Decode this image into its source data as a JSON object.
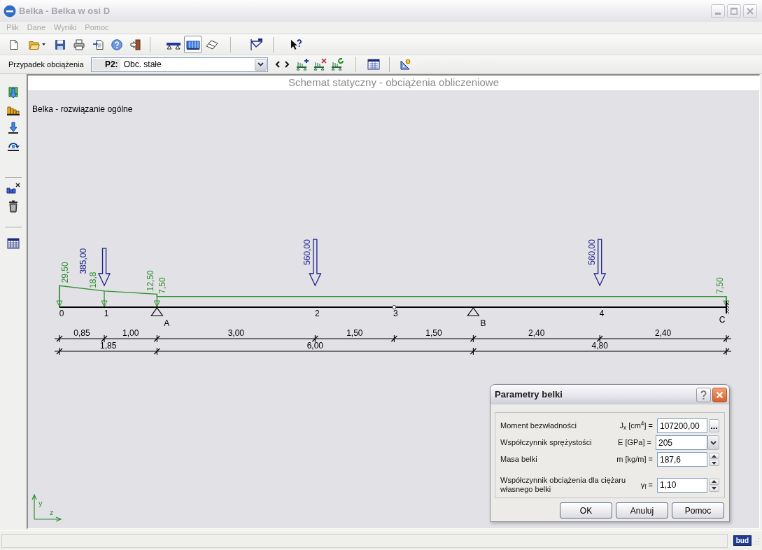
{
  "window": {
    "title": "Belka - Belka w osi D",
    "active": false
  },
  "menu": [
    {
      "label": "Plik",
      "disabled": true
    },
    {
      "label": "Dane",
      "disabled": true
    },
    {
      "label": "Wyniki",
      "disabled": true
    },
    {
      "label": "Pomoc",
      "disabled": true
    }
  ],
  "toolbar": {
    "view_buttons": [
      {
        "kind": "beam",
        "selected": false
      },
      {
        "kind": "loads",
        "selected": true
      },
      {
        "kind": "eraser",
        "selected": false
      }
    ]
  },
  "load_case_bar": {
    "label": "Przypadek obciążenia",
    "case_code": "P2:",
    "case_name": "Obc. stałe"
  },
  "canvas": {
    "title": "Schemat statyczny - obciążenia obliczeniowe",
    "subtitle": "Belka - rozwiązanie ogólne",
    "points": [
      {
        "kind": "node",
        "label": "0",
        "loads": [
          "29,50"
        ]
      },
      {
        "kind": "node",
        "label": "1",
        "loads": [
          "18,8"
        ],
        "force": "385,00"
      },
      {
        "kind": "pin_support",
        "label": "A",
        "loads": [
          "12,50",
          "7,50"
        ]
      },
      {
        "kind": "node",
        "label": "2",
        "force": "560,00"
      },
      {
        "kind": "hinge",
        "label": "3"
      },
      {
        "kind": "pin_support",
        "label": "B"
      },
      {
        "kind": "node",
        "label": "4",
        "force": "560,00"
      },
      {
        "kind": "fixed_support",
        "label": "C",
        "loads": [
          "7,50"
        ]
      }
    ],
    "dimension_rows": [
      [
        "0,85",
        "1,00",
        "3,00",
        "1,50",
        "1,50",
        "2,40",
        "2,40"
      ],
      [
        "1,85",
        "6,00",
        "4,80"
      ]
    ],
    "axes": {
      "vertical": "y",
      "horizontal": "z"
    }
  },
  "dialog": {
    "title": "Parametry belki",
    "fields": [
      {
        "kind": "browse",
        "label": "Moment bezwładności",
        "symbol": "J$_{x}$ [cm$^{4}$] =",
        "value": "107200,00"
      },
      {
        "kind": "dropdown",
        "label": "Współczynnik sprężystości",
        "symbol": "E [GPa] =",
        "value": "205"
      },
      {
        "kind": "spinner",
        "label": "Masa belki",
        "symbol": "m [kg/m] =",
        "value": "187,6"
      },
      {
        "kind": "spinner",
        "label": "Współczynnik obciążenia dla ciężaru własnego belki",
        "symbol": "γ$_{f}$ =",
        "value": "1,10"
      }
    ],
    "buttons": [
      "OK",
      "Anuluj",
      "Pomoc"
    ]
  },
  "status_bar": {
    "logo": "bud"
  }
}
